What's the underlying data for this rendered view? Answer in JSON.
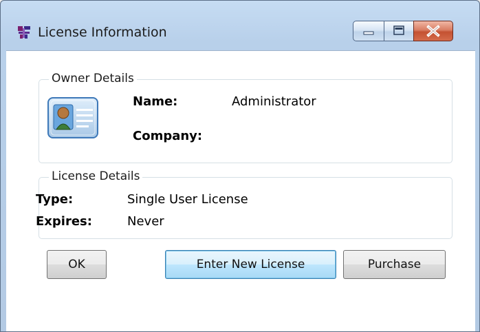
{
  "window": {
    "title": "License Information",
    "icon": "app-icon"
  },
  "caption_buttons": {
    "minimize_icon": "minimize-icon",
    "maximize_icon": "maximize-icon",
    "close_icon": "close-icon"
  },
  "owner_details": {
    "legend": "Owner Details",
    "icon": "contact-card-icon",
    "name_label": "Name:",
    "name_value": "Administrator",
    "company_label": "Company:",
    "company_value": ""
  },
  "license_details": {
    "legend": "License Details",
    "type_label": "Type:",
    "type_value": "Single User License",
    "expires_label": "Expires:",
    "expires_value": "Never"
  },
  "buttons": {
    "ok": "OK",
    "enter_new_license": "Enter New License",
    "purchase": "Purchase"
  },
  "colors": {
    "titlebar": "#b8d0ea",
    "close_button": "#c45232",
    "focus_button_border": "#3c7fb1"
  }
}
